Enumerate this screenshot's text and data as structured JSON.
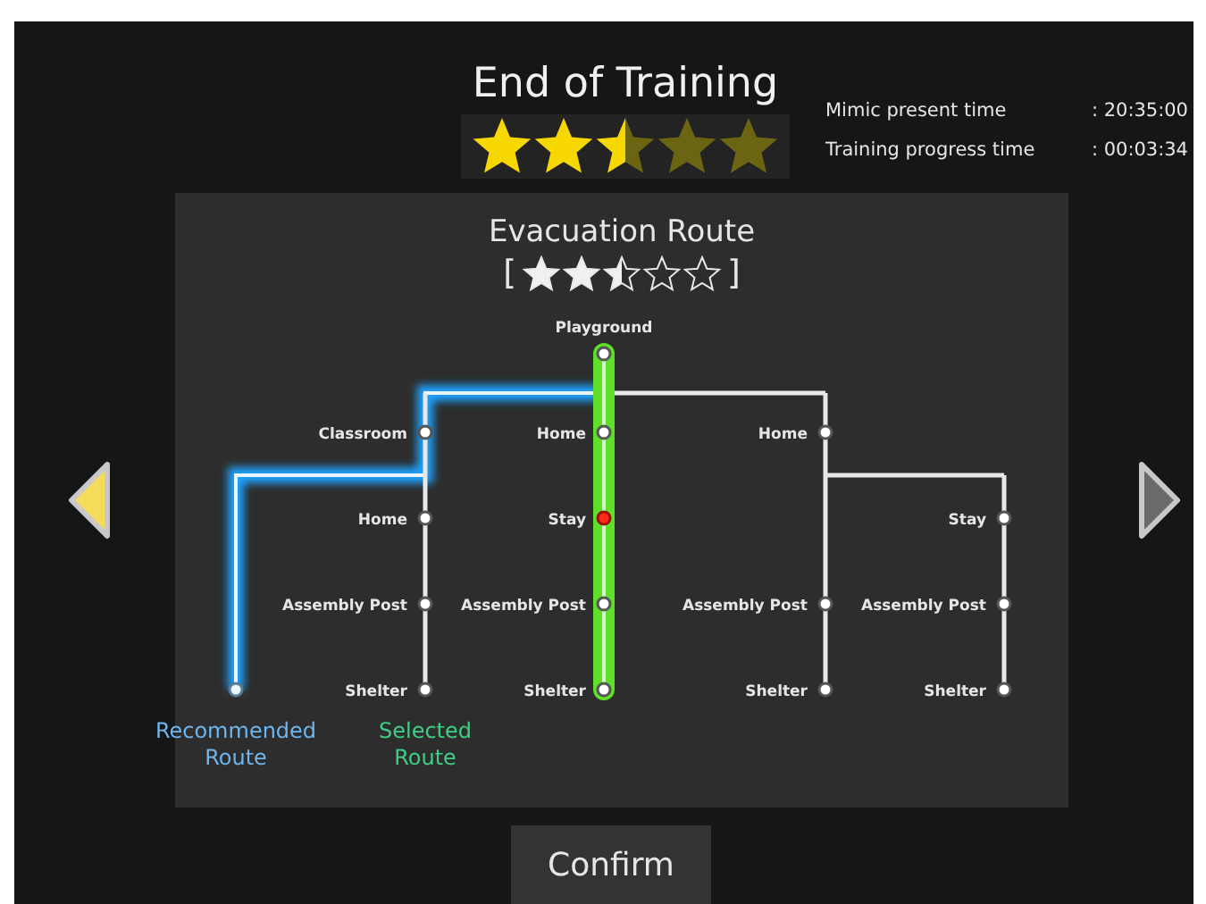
{
  "title": "End of Training",
  "rating": {
    "stars": 2.5
  },
  "info": [
    {
      "label": "Mimic present time",
      "value": ": 20:35:00"
    },
    {
      "label": "Training progress time",
      "value": ": 00:03:34"
    }
  ],
  "route_panel": {
    "title": "Evacuation Route",
    "bracket_open": "[",
    "bracket_close": "]",
    "stars": 2.5,
    "start": {
      "label": "Playground"
    },
    "columns": [
      {
        "selected": false,
        "nodes": [
          {
            "label": "Classroom",
            "alert": false
          },
          {
            "label": "Home",
            "alert": false
          },
          {
            "label": "Assembly Post",
            "alert": false
          },
          {
            "label": "Shelter",
            "alert": false
          }
        ]
      },
      {
        "selected": true,
        "nodes": [
          {
            "label": "Home",
            "alert": false
          },
          {
            "label": "Stay",
            "alert": true
          },
          {
            "label": "Assembly Post",
            "alert": false
          },
          {
            "label": "Shelter",
            "alert": false
          }
        ]
      },
      {
        "selected": false,
        "nodes": [
          {
            "label": "Home",
            "alert": false
          },
          {
            "label": "Assembly Post",
            "alert": false
          },
          {
            "label": "Shelter",
            "alert": false
          }
        ]
      },
      {
        "selected": false,
        "nodes": [
          {
            "label": "Stay",
            "alert": false
          },
          {
            "label": "Assembly Post",
            "alert": false
          },
          {
            "label": "Shelter",
            "alert": false
          }
        ]
      }
    ],
    "legend": [
      {
        "kind": "recommended",
        "label": "Recommended Route"
      },
      {
        "kind": "selected",
        "label": "Selected Route"
      }
    ]
  },
  "nav": [
    {
      "active": true
    },
    {
      "active": false
    }
  ],
  "buttons": [
    "Confirm"
  ]
}
